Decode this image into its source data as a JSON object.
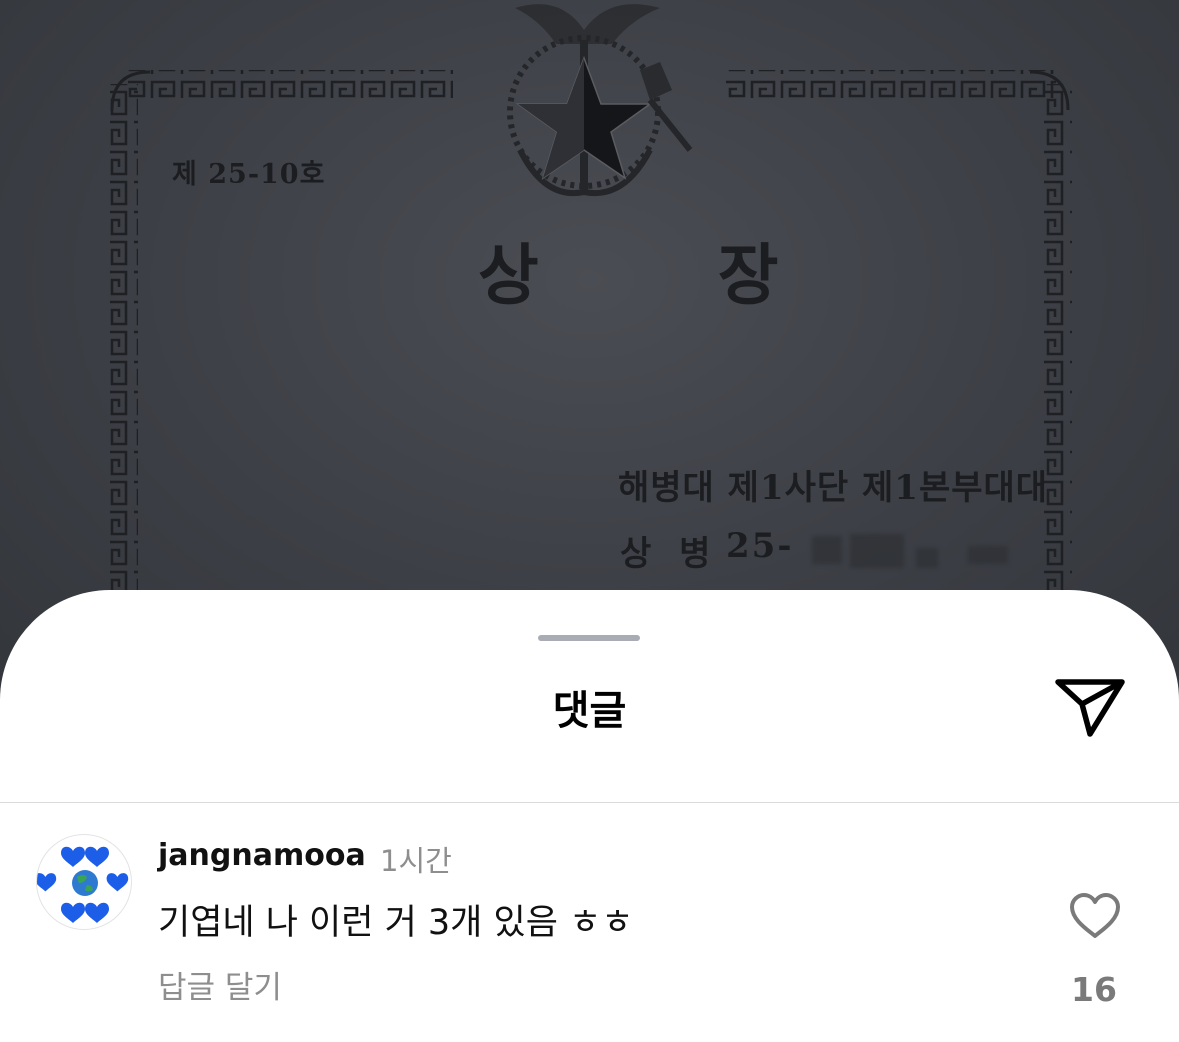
{
  "background": {
    "certificate_number": "제 25-10호",
    "certificate_title": "상 장",
    "unit_line": "해병대 제1사단 제1본부대대",
    "rank": "상 병",
    "serial_prefix": "25-"
  },
  "sheet": {
    "title": "댓글",
    "send_icon": "paper-plane-icon"
  },
  "comments": [
    {
      "username": "jangnamooa",
      "time": "1시간",
      "text": "기엽네 나 이런 거 3개 있음 ㅎㅎ",
      "reply_label": "답글 달기",
      "like_count": "16",
      "avatar_icon": "earth-with-blue-hearts-icon",
      "like_icon": "heart-outline-icon"
    }
  ],
  "colors": {
    "sheet_background": "#ffffff",
    "secondary_text": "#8e8e8e",
    "primary_text": "#111111",
    "divider": "#dbdbdb",
    "grabber": "#a9acb2"
  }
}
